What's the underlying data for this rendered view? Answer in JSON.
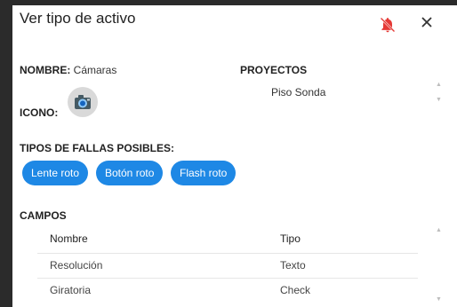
{
  "dialog": {
    "title": "Ver tipo de activo",
    "bell_icon": "bell-off-icon",
    "close_icon": "close-icon",
    "bell_color": "#e53935"
  },
  "nombre": {
    "label": "NOMBRE:",
    "value": "Cámaras"
  },
  "icono": {
    "label": "ICONO:",
    "icon": "camera-icon"
  },
  "proyectos": {
    "label": "PROYECTOS",
    "items": [
      "Piso Sonda"
    ]
  },
  "fallas": {
    "label": "TIPOS DE FALLAS POSIBLES:",
    "chips": [
      "Lente roto",
      "Botón roto",
      "Flash roto"
    ],
    "chip_color": "#1e88e5"
  },
  "campos": {
    "label": "CAMPOS",
    "columns": [
      "Nombre",
      "Tipo"
    ],
    "rows": [
      [
        "Resolución",
        "Texto"
      ],
      [
        "Giratoria",
        "Check"
      ]
    ]
  }
}
